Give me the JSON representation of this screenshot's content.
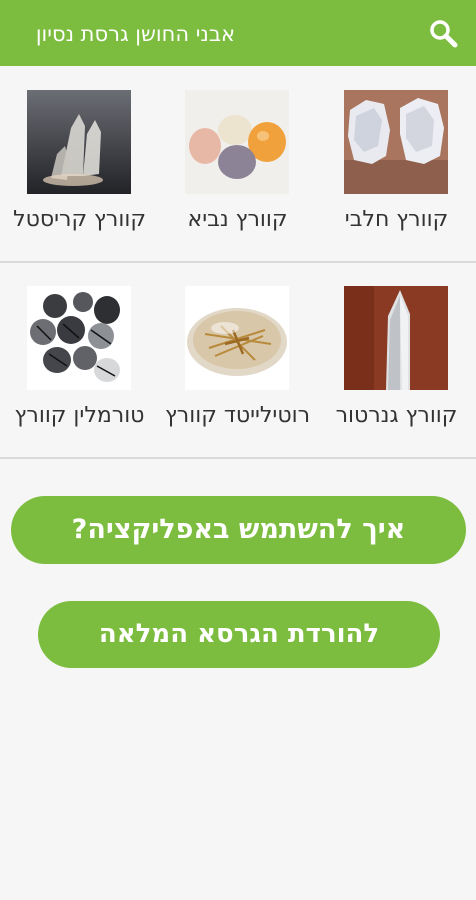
{
  "appbar": {
    "title": "אבני החושן גרסת נסיון",
    "search_icon": "search-icon",
    "background": "#7cbd3f"
  },
  "stones": [
    {
      "label": "קוורץ חלבי",
      "image": "milky-quartz-image"
    },
    {
      "label": "קוורץ נביא",
      "image": "prophet-quartz-image"
    },
    {
      "label": "קוורץ קריסטל",
      "image": "crystal-quartz-image"
    },
    {
      "label": "קוורץ גנרטור",
      "image": "generator-quartz-image"
    },
    {
      "label": "רוטילייטד קוורץ",
      "image": "rutilated-quartz-image"
    },
    {
      "label": "טורמלין קוורץ",
      "image": "tourmaline-quartz-image"
    }
  ],
  "buttons": {
    "how_to_use": "איך להשתמש באפליקציה?",
    "download_full": "להורדת הגרסא המלאה"
  }
}
